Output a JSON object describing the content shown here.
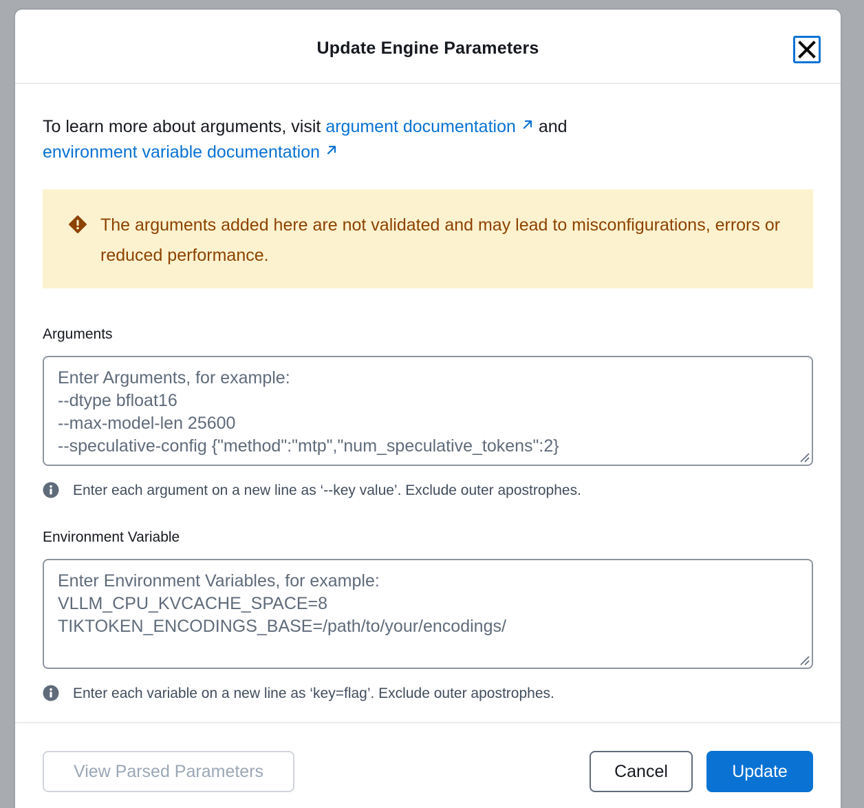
{
  "dialog": {
    "title": "Update Engine Parameters",
    "close_label": "Close"
  },
  "intro": {
    "prefix": "To learn more about arguments, visit ",
    "link1": "argument documentation",
    "middle": " and",
    "link2": "environment variable documentation"
  },
  "alert": {
    "type": "warning",
    "text": "The arguments added here are not validated and may lead to misconfigurations, errors or reduced performance."
  },
  "arguments": {
    "label": "Arguments",
    "value": "",
    "placeholder": "Enter Arguments, for example:\n--dtype bfloat16\n--max-model-len 25600\n--speculative-config {\"method\":\"mtp\",\"num_speculative_tokens\":2}",
    "hint": "Enter each argument on a new line as ‘--key value’. Exclude outer apostrophes."
  },
  "environment": {
    "label": "Environment Variable",
    "value": "",
    "placeholder": "Enter Environment Variables, for example:\nVLLM_CPU_KVCACHE_SPACE=8\nTIKTOKEN_ENCODINGS_BASE=/path/to/your/encodings/",
    "hint": "Enter each variable on a new line as ‘key=flag’. Exclude outer apostrophes."
  },
  "footer": {
    "view_parsed_label": "View Parsed Parameters",
    "cancel_label": "Cancel",
    "update_label": "Update"
  },
  "colors": {
    "primary": "#0972d3",
    "warning_bg": "#fdf2cf",
    "warning_text": "#8d4200",
    "backdrop": "#a8acb1"
  },
  "icons": {
    "close": "close-icon",
    "external_link": "external-link-icon",
    "warning": "warning-icon",
    "info": "info-icon",
    "resize": "resize-handle-icon"
  }
}
